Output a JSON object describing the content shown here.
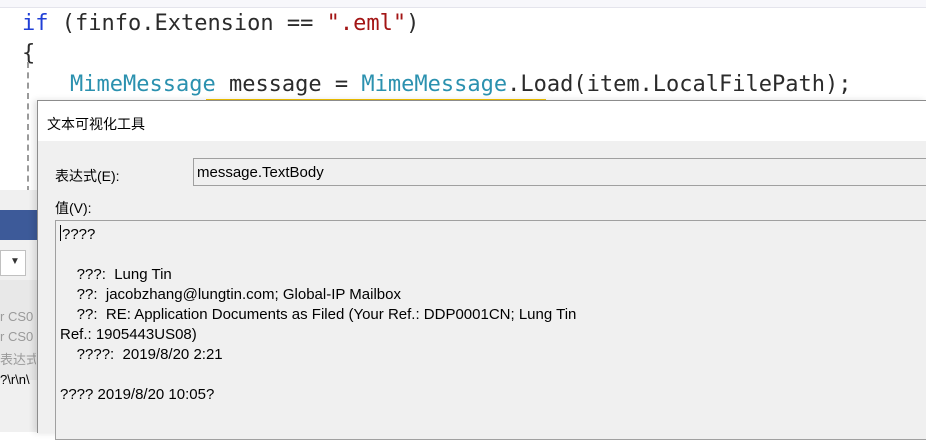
{
  "code": {
    "line1": {
      "kw": "if",
      "rest_before": " (finfo.Extension == ",
      "str": "\".eml\"",
      "rest_after": ")"
    },
    "line2": "{",
    "line3": {
      "type1": "MimeMessage",
      "mid": " message = ",
      "type2": "MimeMessage",
      "rest": ".Load(item.LocalFilePath);"
    }
  },
  "left_panel": {
    "texts": [
      "r CS0",
      "r CS0",
      "表达式",
      "?\\r\\n\\"
    ]
  },
  "dialog": {
    "title": "文本可视化工具",
    "expression_label": "表达式(E):",
    "expression_value": "message.TextBody",
    "value_label": "值(V):",
    "value_lines": [
      "????",
      "",
      "    ???:  Lung Tin",
      "    ??:  jacobzhang@lungtin.com; Global-IP Mailbox",
      "    ??:  RE: Application Documents as Filed (Your Ref.: DDP0001CN; Lung Tin",
      "Ref.: 1905443US08)",
      "    ????:  2019/8/20 2:21",
      "",
      "???? 2019/8/20 10:05?"
    ]
  }
}
